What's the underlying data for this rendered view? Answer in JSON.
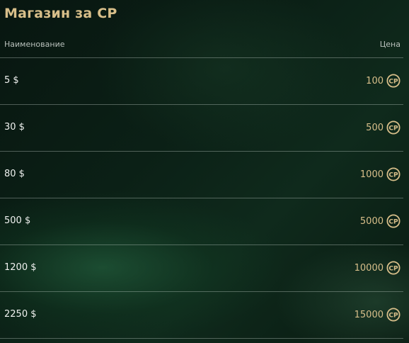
{
  "page": {
    "title": "Магазин за CP"
  },
  "table": {
    "col_name": "Наименование",
    "col_price": "Цена",
    "rows": [
      {
        "name": "5 $",
        "price": "100"
      },
      {
        "name": "30 $",
        "price": "500"
      },
      {
        "name": "80 $",
        "price": "1000"
      },
      {
        "name": "500 $",
        "price": "5000"
      },
      {
        "name": "1200 $",
        "price": "10000"
      },
      {
        "name": "2250 $",
        "price": "15000"
      }
    ]
  },
  "icons": {
    "currency": "cp-coin-icon",
    "currency_label": "CP"
  },
  "colors": {
    "accent_gold": "#d8bf8a",
    "background": "#0b2016"
  }
}
